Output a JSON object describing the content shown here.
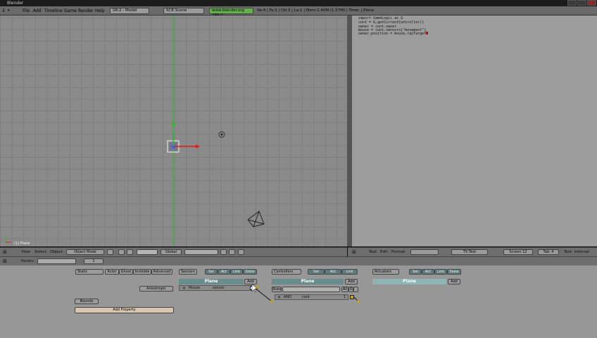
{
  "window": {
    "title": "Blender"
  },
  "topbar": {
    "menus": [
      "File",
      "Add",
      "Timeline",
      "Game",
      "Render",
      "Help"
    ],
    "screen": "SR:2 - Model",
    "scene": "SCE:Scene",
    "url": "www.blender.org 249.2",
    "stats": "Ve:4 | Fa:1 | Ob:3 | La:1 | Mem:1.40M (1.57M) | Time: | Plane"
  },
  "viewport": {
    "label": "(1) Plane",
    "header": {
      "view": "View",
      "select": "Select",
      "object": "Object",
      "mode": "Object Mode",
      "orientation": "Global"
    }
  },
  "text_editor": {
    "code": [
      "import GameLogic as G",
      "cont = G.getCurrentController()",
      "owner = cont.owner",
      "mouse = cont.sensors[\"movement\"]",
      "owner.position = mouse.rayTarget"
    ],
    "header": {
      "text": "Text",
      "edit": "Edit",
      "format": "Format",
      "file": "TX:Text",
      "screen": "Screen 12",
      "tab": "Tab: 4",
      "internal": "Text: Internal"
    }
  },
  "logic": {
    "header": {
      "panels": "Panels",
      "page": "1"
    },
    "props": {
      "static": "Static",
      "actor": "Actor",
      "ghost": "Ghost",
      "invisible": "Invisible",
      "advanced": "Advanced",
      "anisotropic": "Anisotropic",
      "bounds": "Bounds",
      "add_property": "Add Property"
    },
    "sensors": {
      "label": "Sensors",
      "sel": "Sel",
      "act": "Act",
      "link": "Link",
      "state": "State",
      "object": "Plane",
      "add": "Add",
      "type": "Mouse",
      "name": "sensor"
    },
    "controllers": {
      "label": "Controllers",
      "sel": "Sel",
      "act": "Act",
      "link": "Link",
      "object": "Plane",
      "add": "Add",
      "state": "State",
      "type": "AND",
      "name": "cont",
      "all": "All",
      "d": "D",
      "num": "1"
    },
    "actuators": {
      "label": "Actuators",
      "sel": "Sel",
      "act": "Act",
      "link": "Link",
      "state": "State",
      "object": "Plane",
      "add": "Add"
    }
  },
  "colors": {
    "x_axis": "#e02020",
    "y_axis": "#20c020",
    "grid": "#8a8a8a",
    "url_bg": "#63b04c"
  }
}
